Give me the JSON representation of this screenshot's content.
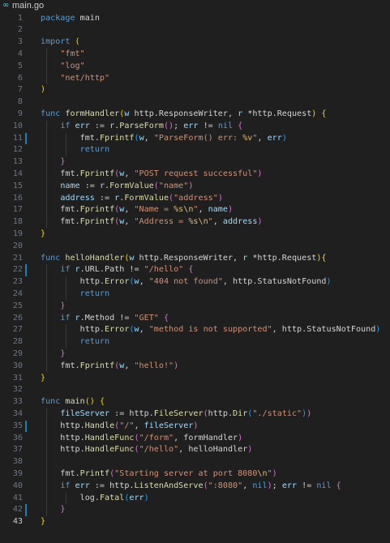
{
  "tab": {
    "title": "main.go",
    "icon": "go-file-icon"
  },
  "colors": {
    "background": "#1f1f1f",
    "keyword": "#569cd6",
    "string": "#ce9178",
    "function": "#dcdcaa",
    "variable": "#9cdcfe",
    "bracket_level1": "#ffd700",
    "bracket_level2": "#da70d6",
    "bracket_level3": "#179fff",
    "gutter_modified": "#1b81a8"
  },
  "active_line": 43,
  "modified_lines": [
    11,
    22,
    35,
    42
  ],
  "lines": [
    {
      "n": "1",
      "tokens": [
        [
          "kw",
          "package"
        ],
        [
          "pl",
          " main"
        ]
      ]
    },
    {
      "n": "2",
      "tokens": []
    },
    {
      "n": "3",
      "tokens": [
        [
          "kw",
          "import"
        ],
        [
          "pl",
          " "
        ],
        [
          "br1",
          "("
        ]
      ]
    },
    {
      "n": "4",
      "tokens": [
        [
          "pl",
          "    "
        ],
        [
          "str",
          "\"fmt\""
        ]
      ]
    },
    {
      "n": "5",
      "tokens": [
        [
          "pl",
          "    "
        ],
        [
          "str",
          "\"log\""
        ]
      ]
    },
    {
      "n": "6",
      "tokens": [
        [
          "pl",
          "    "
        ],
        [
          "str",
          "\"net/http\""
        ]
      ]
    },
    {
      "n": "7",
      "tokens": [
        [
          "br1",
          ")"
        ]
      ]
    },
    {
      "n": "8",
      "tokens": []
    },
    {
      "n": "9",
      "tokens": [
        [
          "kw",
          "func"
        ],
        [
          "pl",
          " "
        ],
        [
          "fn",
          "formHandler"
        ],
        [
          "br1",
          "("
        ],
        [
          "var",
          "w"
        ],
        [
          "pl",
          " http.ResponseWriter, "
        ],
        [
          "var",
          "r"
        ],
        [
          "pl",
          " *http.Request"
        ],
        [
          "br1",
          ")"
        ],
        [
          "pl",
          " "
        ],
        [
          "br1",
          "{"
        ]
      ]
    },
    {
      "n": "10",
      "tokens": [
        [
          "pl",
          "    "
        ],
        [
          "kw",
          "if"
        ],
        [
          "pl",
          " "
        ],
        [
          "var",
          "err"
        ],
        [
          "pl",
          " := "
        ],
        [
          "var",
          "r"
        ],
        [
          "pl",
          "."
        ],
        [
          "fn",
          "ParseForm"
        ],
        [
          "br2",
          "()"
        ],
        [
          "pl",
          "; "
        ],
        [
          "var",
          "err"
        ],
        [
          "pl",
          " != "
        ],
        [
          "kw",
          "nil"
        ],
        [
          "pl",
          " "
        ],
        [
          "br2",
          "{"
        ]
      ]
    },
    {
      "n": "11",
      "tokens": [
        [
          "pl",
          "        fmt."
        ],
        [
          "fn",
          "Fprintf"
        ],
        [
          "br3",
          "("
        ],
        [
          "var",
          "w"
        ],
        [
          "pl",
          ", "
        ],
        [
          "str",
          "\"ParseForm() err: "
        ],
        [
          "esc",
          "%v"
        ],
        [
          "str",
          "\""
        ],
        [
          "pl",
          ", "
        ],
        [
          "var",
          "err"
        ],
        [
          "br3",
          ")"
        ]
      ]
    },
    {
      "n": "12",
      "tokens": [
        [
          "pl",
          "        "
        ],
        [
          "kw",
          "return"
        ]
      ]
    },
    {
      "n": "13",
      "tokens": [
        [
          "pl",
          "    "
        ],
        [
          "br2",
          "}"
        ]
      ]
    },
    {
      "n": "14",
      "tokens": [
        [
          "pl",
          "    fmt."
        ],
        [
          "fn",
          "Fprintf"
        ],
        [
          "br2",
          "("
        ],
        [
          "var",
          "w"
        ],
        [
          "pl",
          ", "
        ],
        [
          "str",
          "\"POST request successful\""
        ],
        [
          "br2",
          ")"
        ]
      ]
    },
    {
      "n": "15",
      "tokens": [
        [
          "pl",
          "    "
        ],
        [
          "var",
          "name"
        ],
        [
          "pl",
          " := "
        ],
        [
          "var",
          "r"
        ],
        [
          "pl",
          "."
        ],
        [
          "fn",
          "FormValue"
        ],
        [
          "br2",
          "("
        ],
        [
          "str",
          "\"name\""
        ],
        [
          "br2",
          ")"
        ]
      ]
    },
    {
      "n": "16",
      "tokens": [
        [
          "pl",
          "    "
        ],
        [
          "var",
          "address"
        ],
        [
          "pl",
          " := "
        ],
        [
          "var",
          "r"
        ],
        [
          "pl",
          "."
        ],
        [
          "fn",
          "FormValue"
        ],
        [
          "br2",
          "("
        ],
        [
          "str",
          "\"address\""
        ],
        [
          "br2",
          ")"
        ]
      ]
    },
    {
      "n": "17",
      "tokens": [
        [
          "pl",
          "    fmt."
        ],
        [
          "fn",
          "Fprintf"
        ],
        [
          "br2",
          "("
        ],
        [
          "var",
          "w"
        ],
        [
          "pl",
          ", "
        ],
        [
          "str",
          "\"Name = "
        ],
        [
          "esc",
          "%s\\n"
        ],
        [
          "str",
          "\""
        ],
        [
          "pl",
          ", "
        ],
        [
          "var",
          "name"
        ],
        [
          "br2",
          ")"
        ]
      ]
    },
    {
      "n": "18",
      "tokens": [
        [
          "pl",
          "    fmt."
        ],
        [
          "fn",
          "Fprintf"
        ],
        [
          "br2",
          "("
        ],
        [
          "var",
          "w"
        ],
        [
          "pl",
          ", "
        ],
        [
          "str",
          "\"Address = "
        ],
        [
          "esc",
          "%s\\n"
        ],
        [
          "str",
          "\""
        ],
        [
          "pl",
          ", "
        ],
        [
          "var",
          "address"
        ],
        [
          "br2",
          ")"
        ]
      ]
    },
    {
      "n": "19",
      "tokens": [
        [
          "br1",
          "}"
        ]
      ]
    },
    {
      "n": "20",
      "tokens": []
    },
    {
      "n": "21",
      "tokens": [
        [
          "kw",
          "func"
        ],
        [
          "pl",
          " "
        ],
        [
          "fn",
          "helloHandler"
        ],
        [
          "br1",
          "("
        ],
        [
          "var",
          "w"
        ],
        [
          "pl",
          " http.ResponseWriter, "
        ],
        [
          "var",
          "r"
        ],
        [
          "pl",
          " *http.Request"
        ],
        [
          "br1",
          ")"
        ],
        [
          "br1",
          "{"
        ]
      ]
    },
    {
      "n": "22",
      "tokens": [
        [
          "pl",
          "    "
        ],
        [
          "kw",
          "if"
        ],
        [
          "pl",
          " "
        ],
        [
          "var",
          "r"
        ],
        [
          "pl",
          ".URL.Path != "
        ],
        [
          "str",
          "\"/hello\""
        ],
        [
          "pl",
          " "
        ],
        [
          "br2",
          "{"
        ]
      ]
    },
    {
      "n": "23",
      "tokens": [
        [
          "pl",
          "        http."
        ],
        [
          "fn",
          "Error"
        ],
        [
          "br3",
          "("
        ],
        [
          "var",
          "w"
        ],
        [
          "pl",
          ", "
        ],
        [
          "str",
          "\"404 not found\""
        ],
        [
          "pl",
          ", http.StatusNotFound"
        ],
        [
          "br3",
          ")"
        ]
      ]
    },
    {
      "n": "24",
      "tokens": [
        [
          "pl",
          "        "
        ],
        [
          "kw",
          "return"
        ]
      ]
    },
    {
      "n": "25",
      "tokens": [
        [
          "pl",
          "    "
        ],
        [
          "br2",
          "}"
        ]
      ]
    },
    {
      "n": "26",
      "tokens": [
        [
          "pl",
          "    "
        ],
        [
          "kw",
          "if"
        ],
        [
          "pl",
          " "
        ],
        [
          "var",
          "r"
        ],
        [
          "pl",
          ".Method != "
        ],
        [
          "str",
          "\"GET\""
        ],
        [
          "pl",
          " "
        ],
        [
          "br2",
          "{"
        ]
      ]
    },
    {
      "n": "27",
      "tokens": [
        [
          "pl",
          "        http."
        ],
        [
          "fn",
          "Error"
        ],
        [
          "br3",
          "("
        ],
        [
          "var",
          "w"
        ],
        [
          "pl",
          ", "
        ],
        [
          "str",
          "\"method is not supported\""
        ],
        [
          "pl",
          ", http.StatusNotFound"
        ],
        [
          "br3",
          ")"
        ]
      ]
    },
    {
      "n": "28",
      "tokens": [
        [
          "pl",
          "        "
        ],
        [
          "kw",
          "return"
        ]
      ]
    },
    {
      "n": "29",
      "tokens": [
        [
          "pl",
          "    "
        ],
        [
          "br2",
          "}"
        ]
      ]
    },
    {
      "n": "30",
      "tokens": [
        [
          "pl",
          "    fmt."
        ],
        [
          "fn",
          "Fprintf"
        ],
        [
          "br2",
          "("
        ],
        [
          "var",
          "w"
        ],
        [
          "pl",
          ", "
        ],
        [
          "str",
          "\"hello!\""
        ],
        [
          "br2",
          ")"
        ]
      ]
    },
    {
      "n": "31",
      "tokens": [
        [
          "br1",
          "}"
        ]
      ]
    },
    {
      "n": "32",
      "tokens": []
    },
    {
      "n": "33",
      "tokens": [
        [
          "kw",
          "func"
        ],
        [
          "pl",
          " "
        ],
        [
          "fn",
          "main"
        ],
        [
          "br1",
          "()"
        ],
        [
          "pl",
          " "
        ],
        [
          "br1",
          "{"
        ]
      ]
    },
    {
      "n": "34",
      "tokens": [
        [
          "pl",
          "    "
        ],
        [
          "var",
          "fileServer"
        ],
        [
          "pl",
          " := http."
        ],
        [
          "fn",
          "FileServer"
        ],
        [
          "br2",
          "("
        ],
        [
          "pl",
          "http."
        ],
        [
          "fn",
          "Dir"
        ],
        [
          "br3",
          "("
        ],
        [
          "str",
          "\"./static\""
        ],
        [
          "br3",
          ")"
        ],
        [
          "br2",
          ")"
        ]
      ]
    },
    {
      "n": "35",
      "tokens": [
        [
          "pl",
          "    http."
        ],
        [
          "fn",
          "Handle"
        ],
        [
          "br2",
          "("
        ],
        [
          "str",
          "\"/\""
        ],
        [
          "pl",
          ", "
        ],
        [
          "var",
          "fileServer"
        ],
        [
          "br2",
          ")"
        ]
      ]
    },
    {
      "n": "36",
      "tokens": [
        [
          "pl",
          "    http."
        ],
        [
          "fn",
          "HandleFunc"
        ],
        [
          "br2",
          "("
        ],
        [
          "str",
          "\"/form\""
        ],
        [
          "pl",
          ", formHandler"
        ],
        [
          "br2",
          ")"
        ]
      ]
    },
    {
      "n": "37",
      "tokens": [
        [
          "pl",
          "    http."
        ],
        [
          "fn",
          "HandleFunc"
        ],
        [
          "br2",
          "("
        ],
        [
          "str",
          "\"/hello\""
        ],
        [
          "pl",
          ", helloHandler"
        ],
        [
          "br2",
          ")"
        ]
      ]
    },
    {
      "n": "38",
      "tokens": []
    },
    {
      "n": "39",
      "tokens": [
        [
          "pl",
          "    fmt."
        ],
        [
          "fn",
          "Printf"
        ],
        [
          "br2",
          "("
        ],
        [
          "str",
          "\"Starting server at port 8080"
        ],
        [
          "esc",
          "\\n"
        ],
        [
          "str",
          "\""
        ],
        [
          "br2",
          ")"
        ]
      ]
    },
    {
      "n": "40",
      "tokens": [
        [
          "pl",
          "    "
        ],
        [
          "kw",
          "if"
        ],
        [
          "pl",
          " "
        ],
        [
          "var",
          "err"
        ],
        [
          "pl",
          " := http."
        ],
        [
          "fn",
          "ListenAndServe"
        ],
        [
          "br2",
          "("
        ],
        [
          "str",
          "\":8080\""
        ],
        [
          "pl",
          ", "
        ],
        [
          "kw",
          "nil"
        ],
        [
          "br2",
          ")"
        ],
        [
          "pl",
          "; "
        ],
        [
          "var",
          "err"
        ],
        [
          "pl",
          " != "
        ],
        [
          "kw",
          "nil"
        ],
        [
          "pl",
          " "
        ],
        [
          "br2",
          "{"
        ]
      ]
    },
    {
      "n": "41",
      "tokens": [
        [
          "pl",
          "        log."
        ],
        [
          "fn",
          "Fatal"
        ],
        [
          "br3",
          "("
        ],
        [
          "var",
          "err"
        ],
        [
          "br3",
          ")"
        ]
      ]
    },
    {
      "n": "42",
      "tokens": [
        [
          "pl",
          "    "
        ],
        [
          "br2",
          "}"
        ]
      ]
    },
    {
      "n": "43",
      "tokens": [
        [
          "br1",
          "}"
        ]
      ]
    }
  ]
}
